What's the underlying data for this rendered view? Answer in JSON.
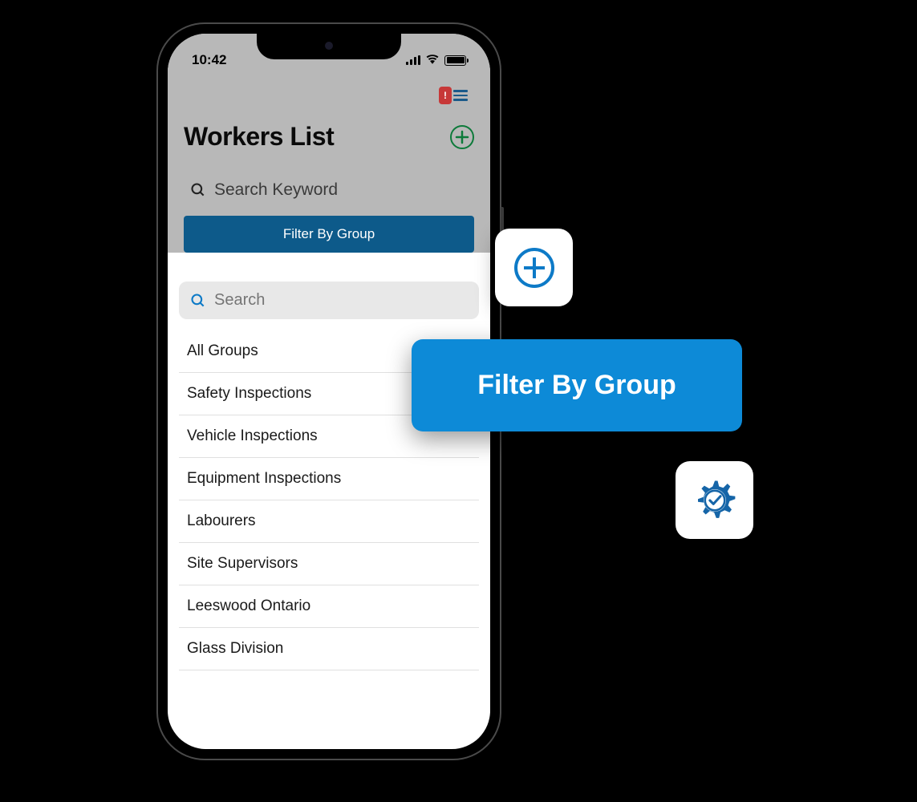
{
  "status_bar": {
    "time": "10:42"
  },
  "header": {
    "notification_badge": "!",
    "title": "Workers List",
    "search_placeholder": "Search Keyword",
    "filter_button": "Filter By Group"
  },
  "dropdown": {
    "search_placeholder": "Search",
    "groups": [
      "All Groups",
      "Safety Inspections",
      "Vehicle Inspections",
      "Equipment Inspections",
      "Labourers",
      "Site Supervisors",
      "Leeswood Ontario",
      "Glass Division"
    ]
  },
  "floating": {
    "filter_label": "Filter By Group"
  }
}
